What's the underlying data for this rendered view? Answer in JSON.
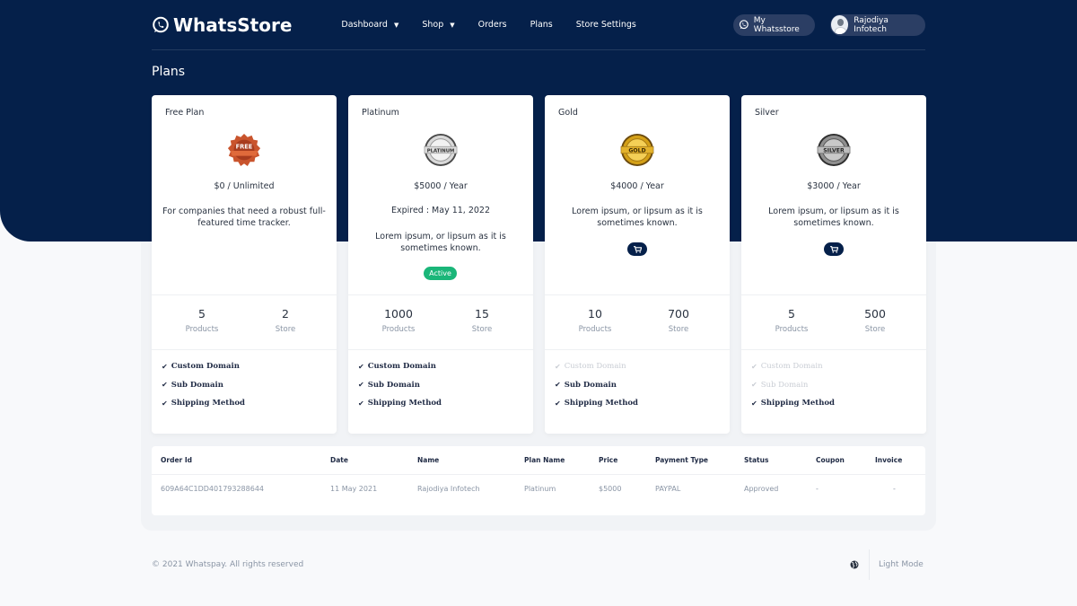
{
  "brand": {
    "name": "WhatsStore"
  },
  "nav": {
    "items": [
      {
        "label": "Dashboard",
        "dropdown": true
      },
      {
        "label": "Shop",
        "dropdown": true
      },
      {
        "label": "Orders",
        "dropdown": false
      },
      {
        "label": "Plans",
        "dropdown": false
      },
      {
        "label": "Store Settings",
        "dropdown": false
      }
    ],
    "my_store_label": "My Whatsstore",
    "user_name": "Rajodiya Infotech"
  },
  "page": {
    "title": "Plans"
  },
  "plans": [
    {
      "name": "Free Plan",
      "badge_text": "FREE",
      "price": "$0 / Unlimited",
      "description": "For companies that need a robust full-featured time tracker.",
      "products": "5",
      "products_label": "Products",
      "store": "2",
      "store_label": "Store",
      "features": [
        {
          "label": "Custom Domain",
          "enabled": true
        },
        {
          "label": "Sub Domain",
          "enabled": true
        },
        {
          "label": "Shipping Method",
          "enabled": true
        }
      ]
    },
    {
      "name": "Platinum",
      "badge_text": "PLATINUM",
      "price": "$5000 / Year",
      "expired": "Expired : May 11, 2022",
      "description": "Lorem ipsum, or lipsum as it is sometimes known.",
      "status_badge": "Active",
      "products": "1000",
      "products_label": "Products",
      "store": "15",
      "store_label": "Store",
      "features": [
        {
          "label": "Custom Domain",
          "enabled": true
        },
        {
          "label": "Sub Domain",
          "enabled": true
        },
        {
          "label": "Shipping Method",
          "enabled": true
        }
      ]
    },
    {
      "name": "Gold",
      "badge_text": "GOLD",
      "price": "$4000 / Year",
      "description": "Lorem ipsum, or lipsum as it is sometimes known.",
      "products": "10",
      "products_label": "Products",
      "store": "700",
      "store_label": "Store",
      "features": [
        {
          "label": "Custom Domain",
          "enabled": false
        },
        {
          "label": "Sub Domain",
          "enabled": true
        },
        {
          "label": "Shipping Method",
          "enabled": true
        }
      ]
    },
    {
      "name": "Silver",
      "badge_text": "SILVER",
      "price": "$3000 / Year",
      "description": "Lorem ipsum, or lipsum as it is sometimes known.",
      "products": "5",
      "products_label": "Products",
      "store": "500",
      "store_label": "Store",
      "features": [
        {
          "label": "Custom Domain",
          "enabled": false
        },
        {
          "label": "Sub Domain",
          "enabled": false
        },
        {
          "label": "Shipping Method",
          "enabled": true
        }
      ]
    }
  ],
  "orders": {
    "columns": [
      "Order Id",
      "Date",
      "Name",
      "Plan Name",
      "Price",
      "Payment Type",
      "Status",
      "Coupon",
      "Invoice"
    ],
    "rows": [
      [
        "609A64C1DD401793288644",
        "11 May 2021",
        "Rajodiya Infotech",
        "Platinum",
        "$5000",
        "PAYPAL",
        "Approved",
        "-",
        "-"
      ]
    ]
  },
  "footer": {
    "copyright": "© 2021 Whatspay. All rights reserved",
    "mode_label": "Light Mode"
  },
  "colors": {
    "navy": "#05204a",
    "active_green": "#1ab679",
    "text_muted": "#8a95a5"
  },
  "icons": {
    "cart": "cart-icon",
    "check": "check-icon",
    "globe": "globe-icon",
    "whatsapp": "whatsapp-icon"
  }
}
